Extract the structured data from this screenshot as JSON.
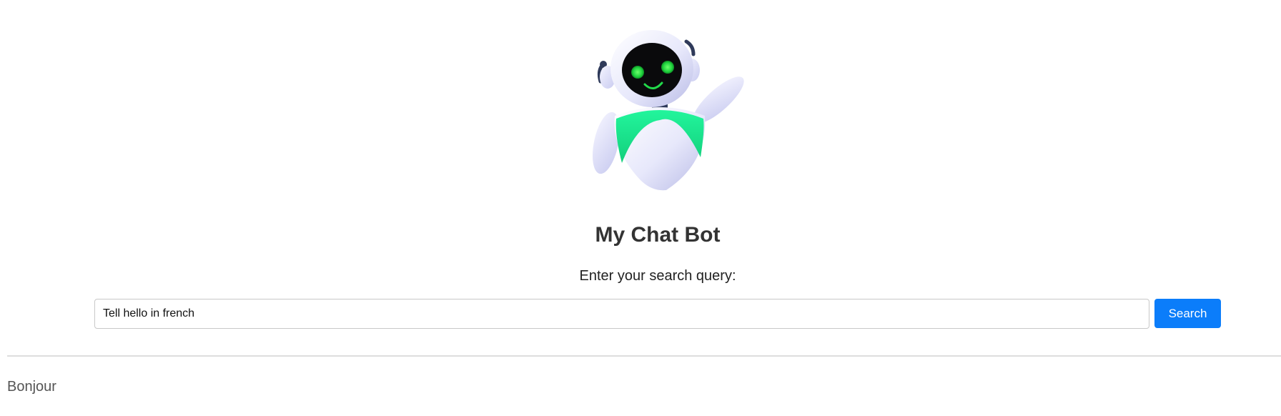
{
  "header": {
    "logo_icon": "robot-mascot-icon",
    "title": "My Chat Bot"
  },
  "search": {
    "label": "Enter your search query:",
    "value": "Tell hello in french",
    "button_label": "Search"
  },
  "result": {
    "text": "Bonjour"
  },
  "colors": {
    "accent": "#0b7dfa",
    "robot_chest": "#1ee88f",
    "robot_eyes": "#22e34a"
  }
}
